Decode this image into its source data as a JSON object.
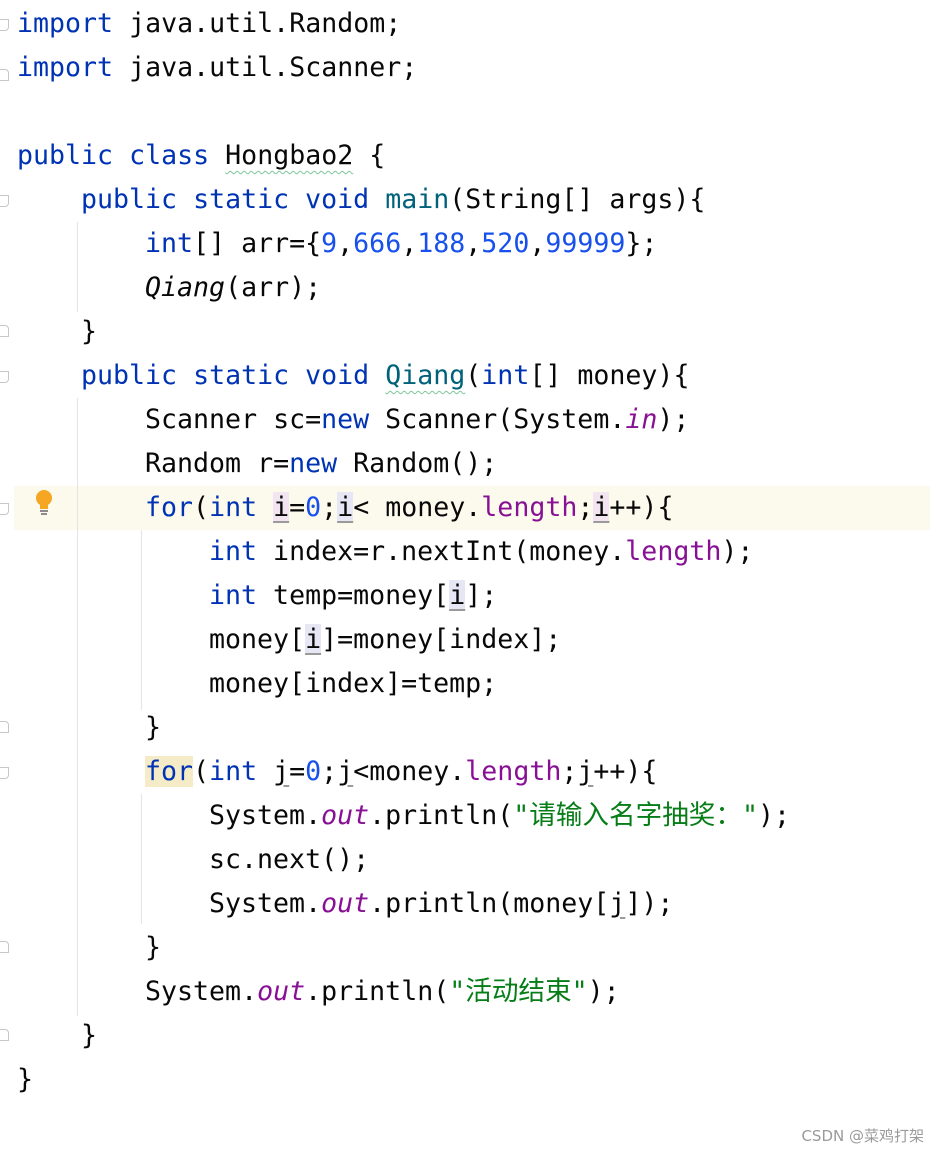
{
  "code": {
    "l1": {
      "kw": "import",
      "rest": " java.util.Random;"
    },
    "l2": {
      "kw": "import",
      "rest": " java.util.Scanner;"
    },
    "l4": {
      "kw1": "public",
      "kw2": "class",
      "cls": "Hongbao2",
      "rest": " {"
    },
    "l5": {
      "kw": "public static void",
      "method": "main",
      "rest": "(String[] args){"
    },
    "l6": {
      "kw": "int",
      "a": "[] arr={",
      "n1": "9",
      "c1": ",",
      "n2": "666",
      "c2": ",",
      "n3": "188",
      "c3": ",",
      "n4": "520",
      "c4": ",",
      "n5": "99999",
      "end": "};"
    },
    "l7": {
      "call": "Qiang",
      "rest": "(arr);"
    },
    "l8": {
      "brace": "}"
    },
    "l9": {
      "kw": "public static void",
      "method": "Qiang",
      "p1": "(",
      "kw2": "int",
      "rest": "[] money){"
    },
    "l10": {
      "a": "Scanner sc=",
      "kw": "new",
      "b": " Scanner(System.",
      "field": "in",
      "end": ");"
    },
    "l11": {
      "a": "Random r=",
      "kw": "new",
      "end": " Random();"
    },
    "l12": {
      "kw": "for",
      "p": "(",
      "kw2": "int",
      "sp": " ",
      "i1": "i",
      "eq": "=",
      "zero": "0",
      "semi": ";",
      "i2": "i",
      "lt": "< money.",
      "len": "length",
      "semi2": ";",
      "i3": "i",
      "end": "++){"
    },
    "l13": {
      "kw": "int",
      "a": " index=r.nextInt(money.",
      "len": "length",
      "end": ");"
    },
    "l14": {
      "kw": "int",
      "a": " temp=money[",
      "i": "i",
      "end": "];"
    },
    "l15": {
      "a": "money[",
      "i": "i",
      "end": "]=money[index];"
    },
    "l16": {
      "text": "money[index]=temp;"
    },
    "l17": {
      "brace": "}"
    },
    "l18": {
      "kw": "for",
      "p": "(",
      "kw2": "int",
      "sp": " ",
      "j1": "j",
      "eq": "=",
      "zero": "0",
      "semi": ";",
      "j2": "j",
      "lt": "<money.",
      "len": "length",
      "semi2": ";",
      "j3": "j",
      "end": "++){"
    },
    "l19": {
      "a": "System.",
      "field": "out",
      "b": ".println(",
      "str": "\"请输入名字抽奖：\"",
      "end": ");"
    },
    "l20": {
      "text": "sc.next();"
    },
    "l21": {
      "a": "System.",
      "field": "out",
      "b": ".println(money[",
      "j": "j",
      "end": "]);"
    },
    "l22": {
      "brace": "}"
    },
    "l23": {
      "a": "System.",
      "field": "out",
      "b": ".println(",
      "str": "\"活动结束\"",
      "end": ");"
    },
    "l24": {
      "brace": "}"
    },
    "l25": {
      "brace": "}"
    }
  },
  "watermark": "CSDN @菜鸡打架",
  "colors": {
    "keyword": "#0033b3",
    "number": "#1750eb",
    "field": "#871094",
    "string": "#067d17",
    "method_decl": "#00627a",
    "text": "#080808",
    "current_line": "#fcfaed",
    "bulb": "#f5a623"
  },
  "icons": {
    "intention": "lightbulb-icon",
    "fold": "fold-marker-icon"
  }
}
